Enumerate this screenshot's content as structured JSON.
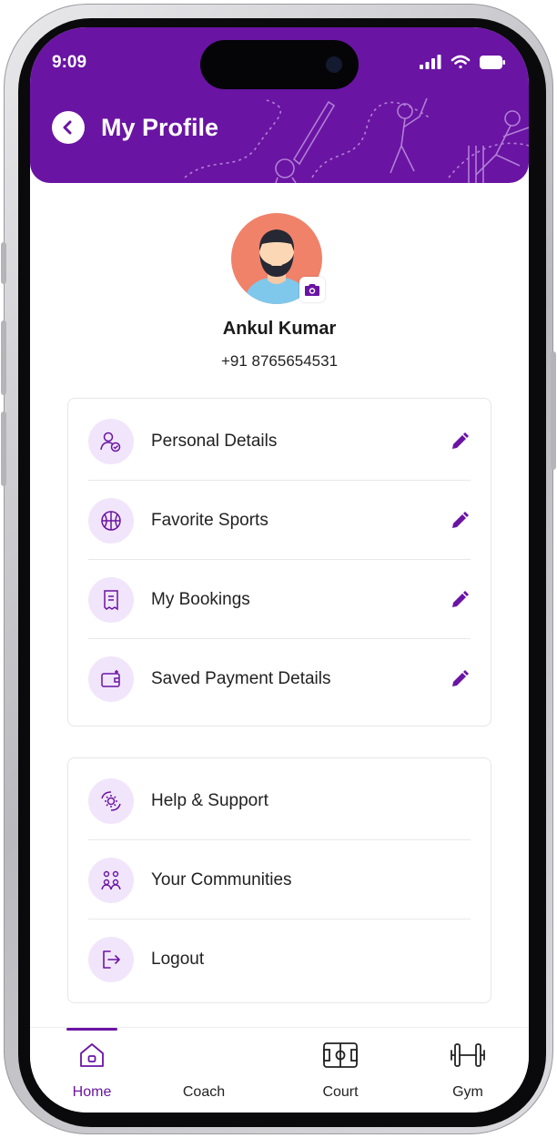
{
  "status_bar": {
    "time": "9:09"
  },
  "header": {
    "title": "My Profile"
  },
  "profile": {
    "name": "Ankul Kumar",
    "phone": "+91 8765654531"
  },
  "account_menu": [
    {
      "label": "Personal Details",
      "icon": "user-check-icon"
    },
    {
      "label": "Favorite Sports",
      "icon": "basketball-icon"
    },
    {
      "label": "My Bookings",
      "icon": "receipt-icon"
    },
    {
      "label": "Saved Payment Details",
      "icon": "wallet-icon"
    }
  ],
  "support_menu": [
    {
      "label": "Help & Support",
      "icon": "help-settings-icon"
    },
    {
      "label": "Your Communities",
      "icon": "community-icon"
    },
    {
      "label": "Logout",
      "icon": "logout-icon"
    }
  ],
  "bottom_nav": [
    {
      "label": "Home",
      "icon": "home-icon",
      "active": true
    },
    {
      "label": "Coach",
      "icon": ""
    },
    {
      "label": "Court",
      "icon": "court-icon"
    },
    {
      "label": "Gym",
      "icon": "dumbbell-icon"
    }
  ],
  "colors": {
    "brand": "#6a14a3",
    "icon_bg": "#f1e5fb",
    "avatar_bg": "#f0826a"
  }
}
